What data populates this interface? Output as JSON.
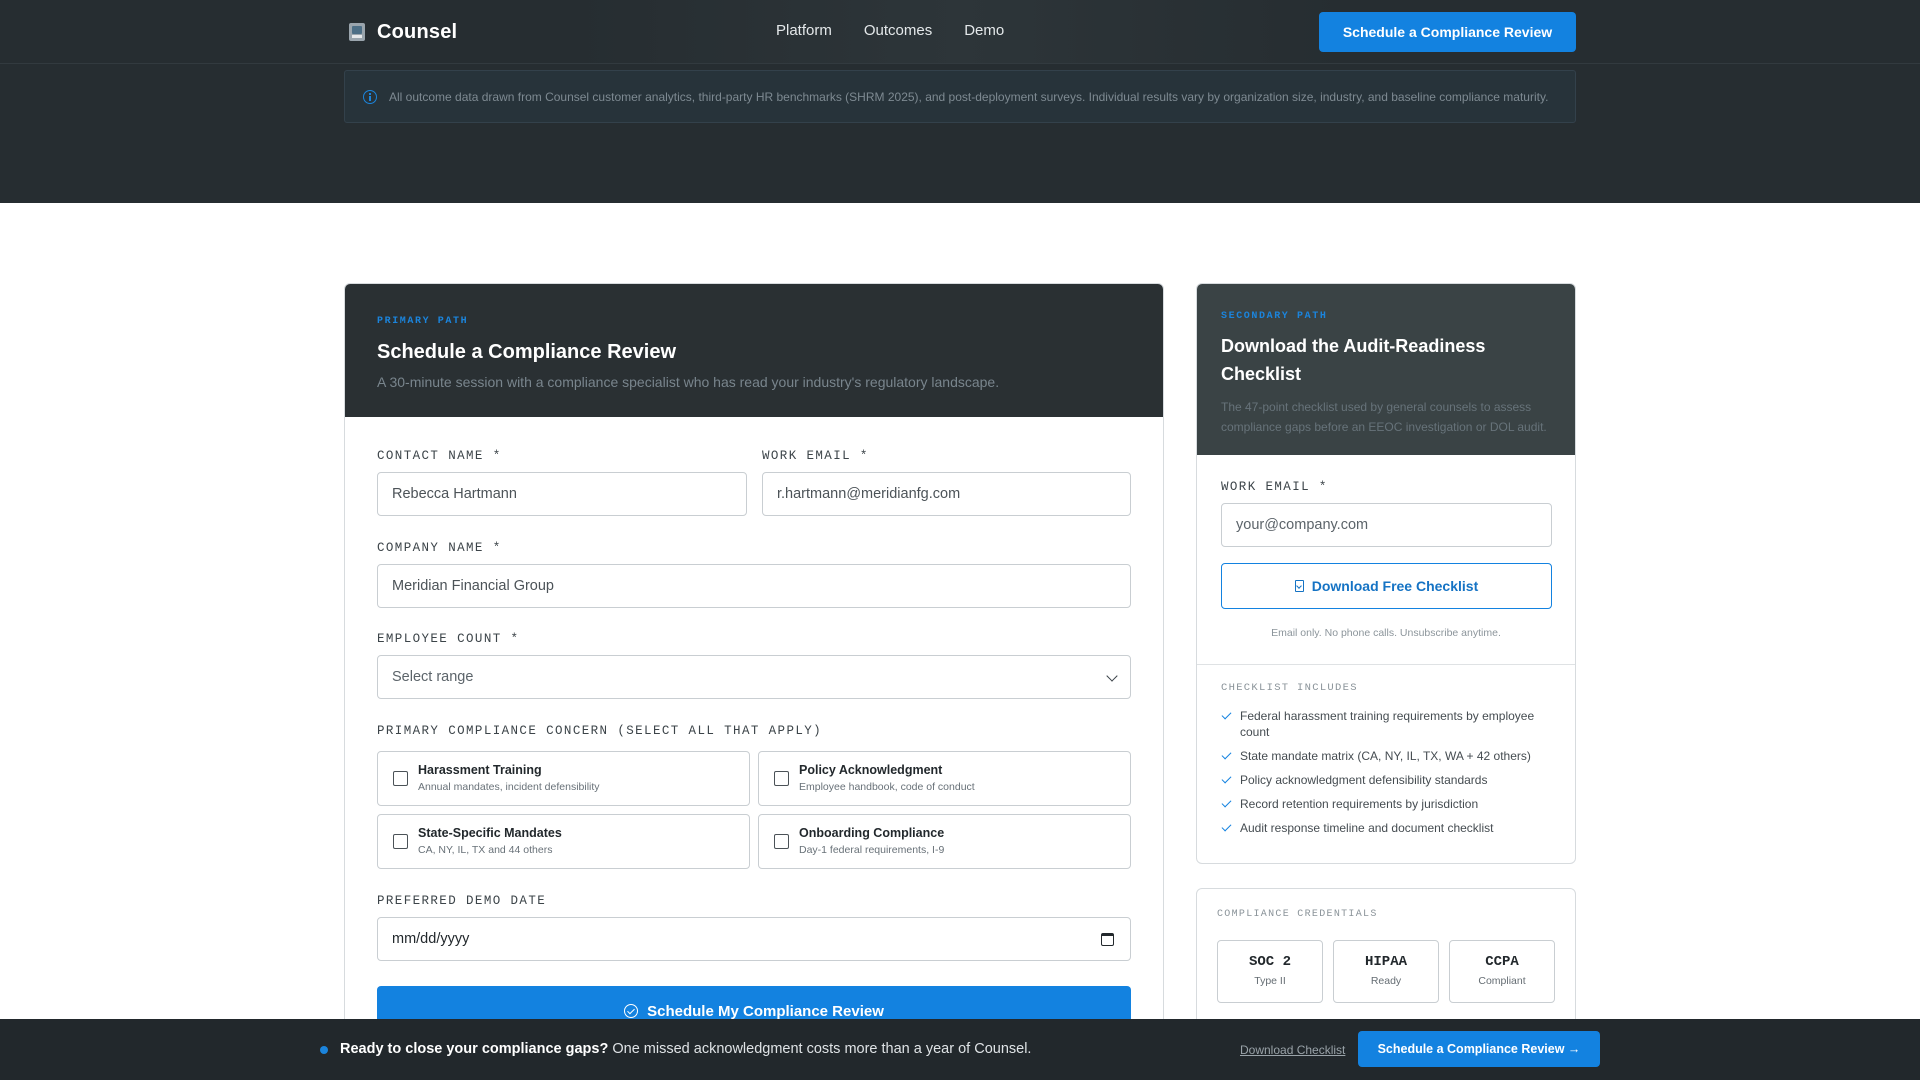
{
  "nav": {
    "brand": "Counsel",
    "links": [
      "Platform",
      "Outcomes",
      "Demo"
    ],
    "cta": "Schedule a Compliance Review"
  },
  "notice": {
    "text": "All outcome data drawn from Counsel customer analytics, third-party HR benchmarks (SHRM 2025), and post-deployment surveys. Individual results vary by organization size, industry, and baseline compliance maturity."
  },
  "primary": {
    "eyebrow": "PRIMARY PATH",
    "title": "Schedule a Compliance Review",
    "subtitle": "A 30-minute session with a compliance specialist who has read your industry's regulatory landscape.",
    "fields": {
      "contact_name": {
        "label": "CONTACT NAME *",
        "value": "Rebecca Hartmann"
      },
      "work_email": {
        "label": "WORK EMAIL *",
        "value": "r.hartmann@meridianfg.com"
      },
      "company_name": {
        "label": "COMPANY NAME *",
        "value": "Meridian Financial Group"
      },
      "employee_count": {
        "label": "EMPLOYEE COUNT *",
        "value": "Select range"
      },
      "concern_label": "PRIMARY COMPLIANCE CONCERN (SELECT ALL THAT APPLY)",
      "demo_date": {
        "label": "PREFERRED DEMO DATE",
        "value": "mm/dd/yyyy"
      }
    },
    "concerns": [
      {
        "title": "Harassment Training",
        "desc": "Annual mandates, incident defensibility",
        "checked": false
      },
      {
        "title": "Policy Acknowledgment",
        "desc": "Employee handbook, code of conduct",
        "checked": false
      },
      {
        "title": "State-Specific Mandates",
        "desc": "CA, NY, IL, TX and 44 others",
        "checked": false
      },
      {
        "title": "Onboarding Compliance",
        "desc": "Day-1 federal requirements, I-9",
        "checked": false
      }
    ],
    "submit": "Schedule My Compliance Review"
  },
  "secondary": {
    "eyebrow": "SECONDARY PATH",
    "title": "Download the Audit-Readiness Checklist",
    "subtitle": "The 47-point checklist used by general counsels to assess compliance gaps before an EEOC investigation or DOL audit.",
    "email_label": "WORK EMAIL *",
    "email_placeholder": "your@company.com",
    "button": "Download Free Checklist",
    "fine_print": "Email only. No phone calls. Unsubscribe anytime.",
    "includes_label": "CHECKLIST INCLUDES",
    "includes": [
      "Federal harassment training requirements by employee count",
      "State mandate matrix (CA, NY, IL, TX, WA + 42 others)",
      "Policy acknowledgment defensibility standards",
      "Record retention requirements by jurisdiction",
      "Audit response timeline and document checklist"
    ]
  },
  "credentials": {
    "label": "COMPLIANCE CREDENTIALS",
    "items": [
      {
        "name": "SOC 2",
        "sub": "Type II"
      },
      {
        "name": "HIPAA",
        "sub": "Ready"
      },
      {
        "name": "CCPA",
        "sub": "Compliant"
      }
    ]
  },
  "sticky": {
    "lead": "Ready to close your compliance gaps?",
    "text": "One missed acknowledgment costs more than a year of Counsel.",
    "link": "Download Checklist",
    "cta": "Schedule a Compliance Review →"
  },
  "colors": {
    "accent": "#1382e0",
    "dark": "#262d31",
    "card_head": "#2a3033",
    "secondary_head": "#3a4345"
  }
}
